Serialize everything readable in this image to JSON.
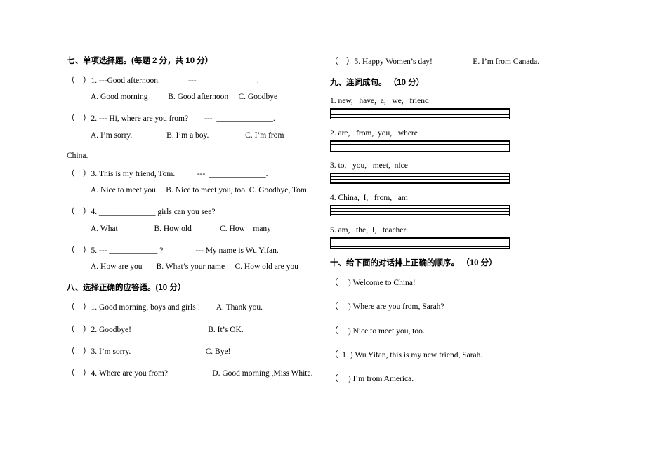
{
  "document": {
    "title": "English Exam Worksheet"
  },
  "left_column": {
    "section7": {
      "heading": "七、单项选择题。(每题 2 分，共 10 分）",
      "questions": [
        {
          "stem": "（    ）1. ---Good afternoon.              ---  ______________.",
          "options": "A. Good morning          B. Good afternoon     C. Goodbye"
        },
        {
          "stem": "（    ）2. --- Hi, where are you from?        ---  ______________.",
          "options": "A. I’m sorry.                 B. I’m a boy.                  C. I’m from",
          "continuation": "China."
        },
        {
          "stem": "（    ）3. This is my friend, Tom.           ---  ______________.",
          "options": "A. Nice to meet you.    B. Nice to meet you, too. C. Goodbye, Tom"
        },
        {
          "stem": "（    ）4. ______________ girls can you see?",
          "options": "A. What                  B. How old              C. How    many"
        },
        {
          "stem": "（    ）5. --- ____________ ?                --- My name is Wu Yifan.",
          "options": "A. How are you       B. What’s your name     C. How old are you"
        }
      ]
    },
    "section8": {
      "heading": "八、选择正确的应答语。(10 分）",
      "items": [
        "（    ）1. Good morning, boys and girls !        A. Thank you.",
        "（    ）2. Goodbye!                                      B. It’s OK.",
        "（    ）3. I’m sorry.                                     C. Bye!",
        "（    ）4. Where are you from?                      D. Good morning ,Miss White."
      ]
    }
  },
  "right_column": {
    "section8_cont": {
      "item5": "（    ）5. Happy Women’s day!                    E. I’m from Canada."
    },
    "section9": {
      "heading": "九、连词成句。 （10 分）",
      "sentences": [
        "1. new,   have,  a,   we,   friend",
        "2. are,   from,  you,   where",
        "3. to,   you,   meet,  nice",
        "4. China,  I,   from,   am",
        "5. am,   the,  I,   teacher"
      ]
    },
    "section10": {
      "heading": "十、给下面的对话排上正确的顺序。 （10 分）",
      "items": [
        "（     ) Welcome to China!",
        "（     ) Where are you from, Sarah?",
        "（     ) Nice to meet you, too.",
        "（  1  ) Wu Yifan, this is my new friend, Sarah.",
        "（     ) I’m from America."
      ]
    }
  }
}
